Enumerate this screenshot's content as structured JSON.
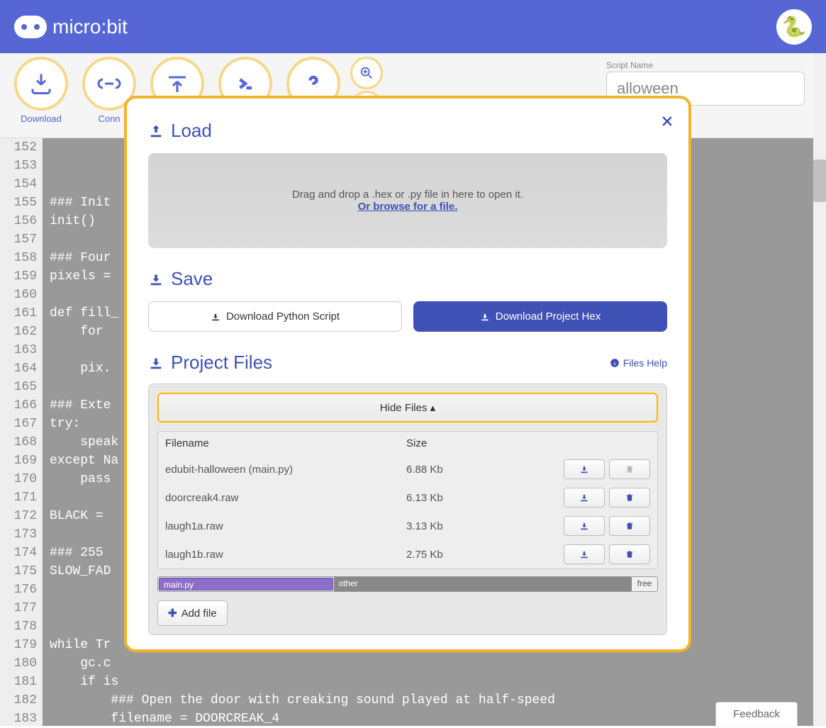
{
  "header": {
    "brand": "micro:bit"
  },
  "toolbar": {
    "download": "Download",
    "connect": "Conn",
    "script_name_label": "Script Name",
    "script_name_value": "alloween"
  },
  "modal": {
    "load_title": "Load",
    "drop_text": "Drag and drop a .hex or .py file in here to open it.",
    "browse_link": "Or browse for a file.",
    "save_title": "Save",
    "dl_script": "Download Python Script",
    "dl_hex": "Download Project Hex",
    "proj_title": "Project Files",
    "files_help": "Files Help",
    "hide_files": "Hide Files",
    "col_filename": "Filename",
    "col_size": "Size",
    "files": [
      {
        "name": "edubit-halloween (main.py)",
        "size": "6.88 Kb",
        "deletable": false
      },
      {
        "name": "doorcreak4.raw",
        "size": "6.13 Kb",
        "deletable": true
      },
      {
        "name": "laugh1a.raw",
        "size": "3.13 Kb",
        "deletable": true
      },
      {
        "name": "laugh1b.raw",
        "size": "2.75 Kb",
        "deletable": true
      }
    ],
    "space": {
      "main": "main.py",
      "other": "other",
      "free": "free"
    },
    "add_file": "Add file"
  },
  "editor": {
    "first_line": 152,
    "lines": [
      "",
      "",
      "",
      "### Init",
      "init()",
      "",
      "### Four",
      "pixels =",
      "",
      "def fill_",
      "    for ",
      "        ",
      "    pix.",
      "",
      "### Exte",
      "try:",
      "    speak",
      "except Na",
      "    pass",
      "",
      "BLACK = ",
      "",
      "### 255 ",
      "SLOW_FAD",
      "",
      "",
      "",
      "while Tr",
      "    gc.c",
      "    if is",
      "        ### Open the door with creaking sound played at half-speed",
      "        filename = DOORCREAK_4"
    ]
  },
  "feedback": "Feedback"
}
